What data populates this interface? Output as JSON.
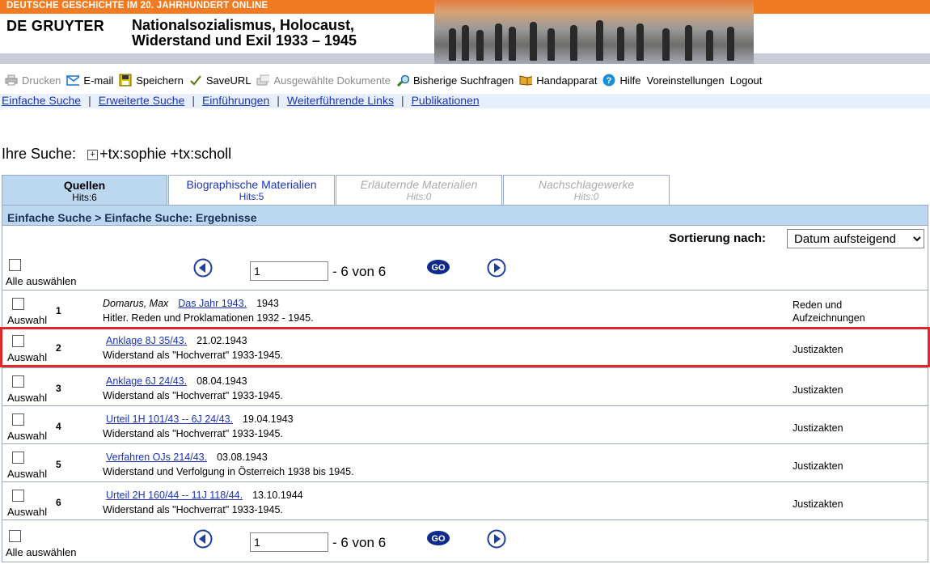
{
  "banner": {
    "series": "DEUTSCHE GESCHICHTE IM 20. JAHRHUNDERT ONLINE",
    "publisher": "DE GRUYTER",
    "title_line1": "Nationalsozialismus, Holocaust,",
    "title_line2": "Widerstand und Exil 1933 – 1945"
  },
  "toolbar": {
    "print": "Drucken",
    "email": "E-mail",
    "save": "Speichern",
    "saveurl": "SaveURL",
    "selected_docs": "Ausgewählte Dokumente",
    "previous_queries": "Bisherige Suchfragen",
    "handapparat": "Handapparat",
    "help": "Hilfe",
    "settings": "Voreinstellungen",
    "logout": "Logout"
  },
  "nav": {
    "simple_search": "Einfache Suche",
    "advanced_search": "Erweiterte Suche",
    "introductions": "Einführungen",
    "further_links": "Weiterführende Links",
    "publications": "Publikationen",
    "separator": "|"
  },
  "search": {
    "label": "Ihre Suche:",
    "query": "+tx:sophie +tx:scholl"
  },
  "tabs": [
    {
      "label": "Quellen",
      "hits": "Hits:6"
    },
    {
      "label": "Biographische Materialien",
      "hits": "Hits:5"
    },
    {
      "label": "Erläuternde Materialien",
      "hits": "Hits:0"
    },
    {
      "label": "Nachschlagewerke",
      "hits": "Hits:0"
    }
  ],
  "breadcrumb": "Einfache Suche > Einfache Suche: Ergebnisse",
  "sort": {
    "label": "Sortierung nach:",
    "selected": "Datum aufsteigend"
  },
  "pager": {
    "select_all": "Alle auswählen",
    "page": "1",
    "of_text": "- 6 von 6",
    "go": "GO"
  },
  "row_select_label": "Auswahl",
  "results": [
    {
      "num": "1",
      "author": "Domarus, Max",
      "link": "Das Jahr 1943.",
      "date": "1943",
      "source": "Hitler. Reden und Proklamationen 1932 - 1945.",
      "category": "Reden und Aufzeichnungen",
      "highlighted": false
    },
    {
      "num": "2",
      "author": "",
      "link": "Anklage 8J 35/43.",
      "date": "21.02.1943",
      "source": "Widerstand als \"Hochverrat\" 1933-1945.",
      "category": "Justizakten",
      "highlighted": true
    },
    {
      "num": "3",
      "author": "",
      "link": "Anklage 6J 24/43.",
      "date": "08.04.1943",
      "source": "Widerstand als \"Hochverrat\" 1933-1945.",
      "category": "Justizakten",
      "highlighted": false
    },
    {
      "num": "4",
      "author": "",
      "link": "Urteil 1H 101/43 -- 6J 24/43.",
      "date": "19.04.1943",
      "source": "Widerstand als \"Hochverrat\" 1933-1945.",
      "category": "Justizakten",
      "highlighted": false
    },
    {
      "num": "5",
      "author": "",
      "link": "Verfahren OJs 214/43.",
      "date": "03.08.1943",
      "source": "Widerstand und Verfolgung in Österreich 1938 bis 1945.",
      "category": "Justizakten",
      "highlighted": false
    },
    {
      "num": "6",
      "author": "",
      "link": "Urteil 2H 160/44 -- 11J 118/44.",
      "date": "13.10.1944",
      "source": "Widerstand als \"Hochverrat\" 1933-1945.",
      "category": "Justizakten",
      "highlighted": false
    }
  ],
  "colors": {
    "orange": "#f07b22",
    "link": "#1a33b8",
    "tab_active": "#bcd8f1",
    "highlight_border": "#e0282a"
  }
}
